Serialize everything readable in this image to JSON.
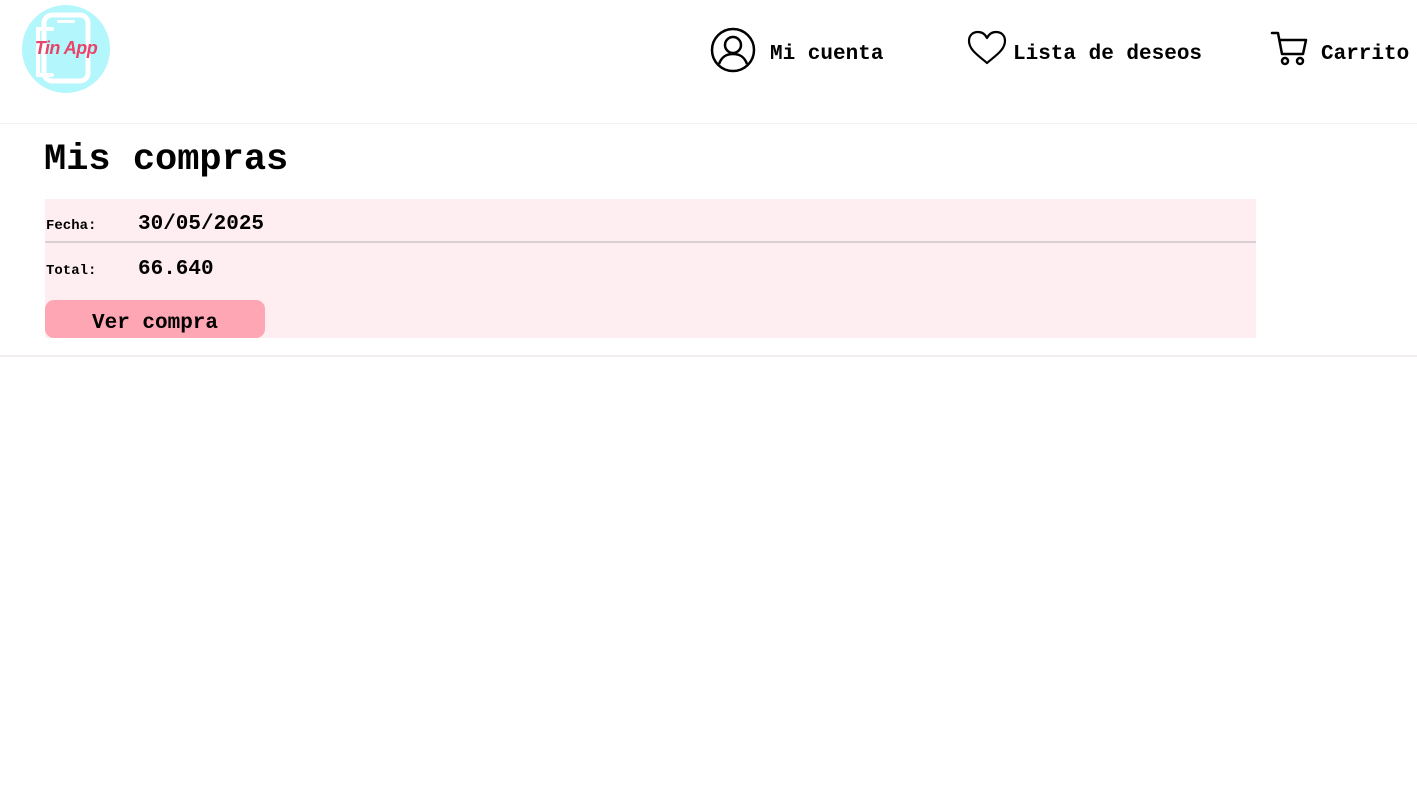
{
  "header": {
    "logo": {
      "text": "Tin App",
      "icon": "tin-app-logo"
    },
    "nav": {
      "account": {
        "label": "Mi cuenta",
        "icon": "user-circle-icon"
      },
      "wishlist": {
        "label": "Lista de deseos",
        "icon": "heart-icon"
      },
      "cart": {
        "label": "Carrito",
        "icon": "cart-icon"
      }
    }
  },
  "main": {
    "title": "Mis compras",
    "orders": [
      {
        "date_label": "Fecha:",
        "date_value": "30/05/2025",
        "total_label": "Total:",
        "total_value": "66.640",
        "view_button": "Ver compra"
      }
    ]
  },
  "colors": {
    "logo_bg": "#b3f6fb",
    "logo_text": "#e7456a",
    "card_bg": "#ffeef1",
    "button_bg": "#ffa6b4"
  }
}
